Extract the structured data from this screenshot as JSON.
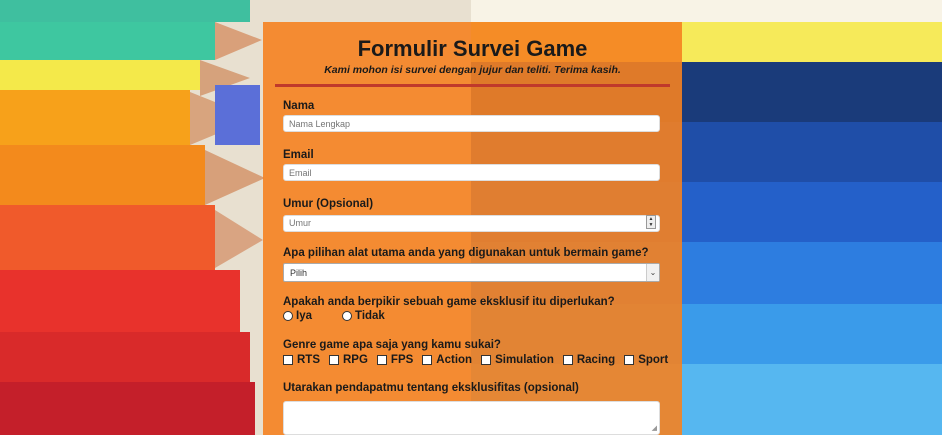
{
  "form": {
    "title": "Formulir Survei Game",
    "subtitle": "Kami mohon isi survei dengan jujur dan teliti. Terima kasih.",
    "name": {
      "label": "Nama",
      "placeholder": "Nama Lengkap"
    },
    "email": {
      "label": "Email",
      "placeholder": "Email"
    },
    "age": {
      "label": "Umur (Opsional)",
      "placeholder": "Umur"
    },
    "device": {
      "label": "Apa pilihan alat utama anda yang digunakan untuk bermain game?",
      "selected": "Pilih"
    },
    "exclusive": {
      "label": "Apakah anda berpikir sebuah game eksklusif itu diperlukan?",
      "options": [
        "Iya",
        "Tidak"
      ]
    },
    "genres": {
      "label": "Genre game apa saja yang kamu sukai?",
      "options": [
        "RTS",
        "RPG",
        "FPS",
        "Action",
        "Simulation",
        "Racing",
        "Sport"
      ]
    },
    "opinion": {
      "label": "Utarakan pendapatmu tentang eksklusifitas (opsional)"
    }
  },
  "colors": {
    "form_bg": "#f58220",
    "divider": "#c0392b"
  }
}
